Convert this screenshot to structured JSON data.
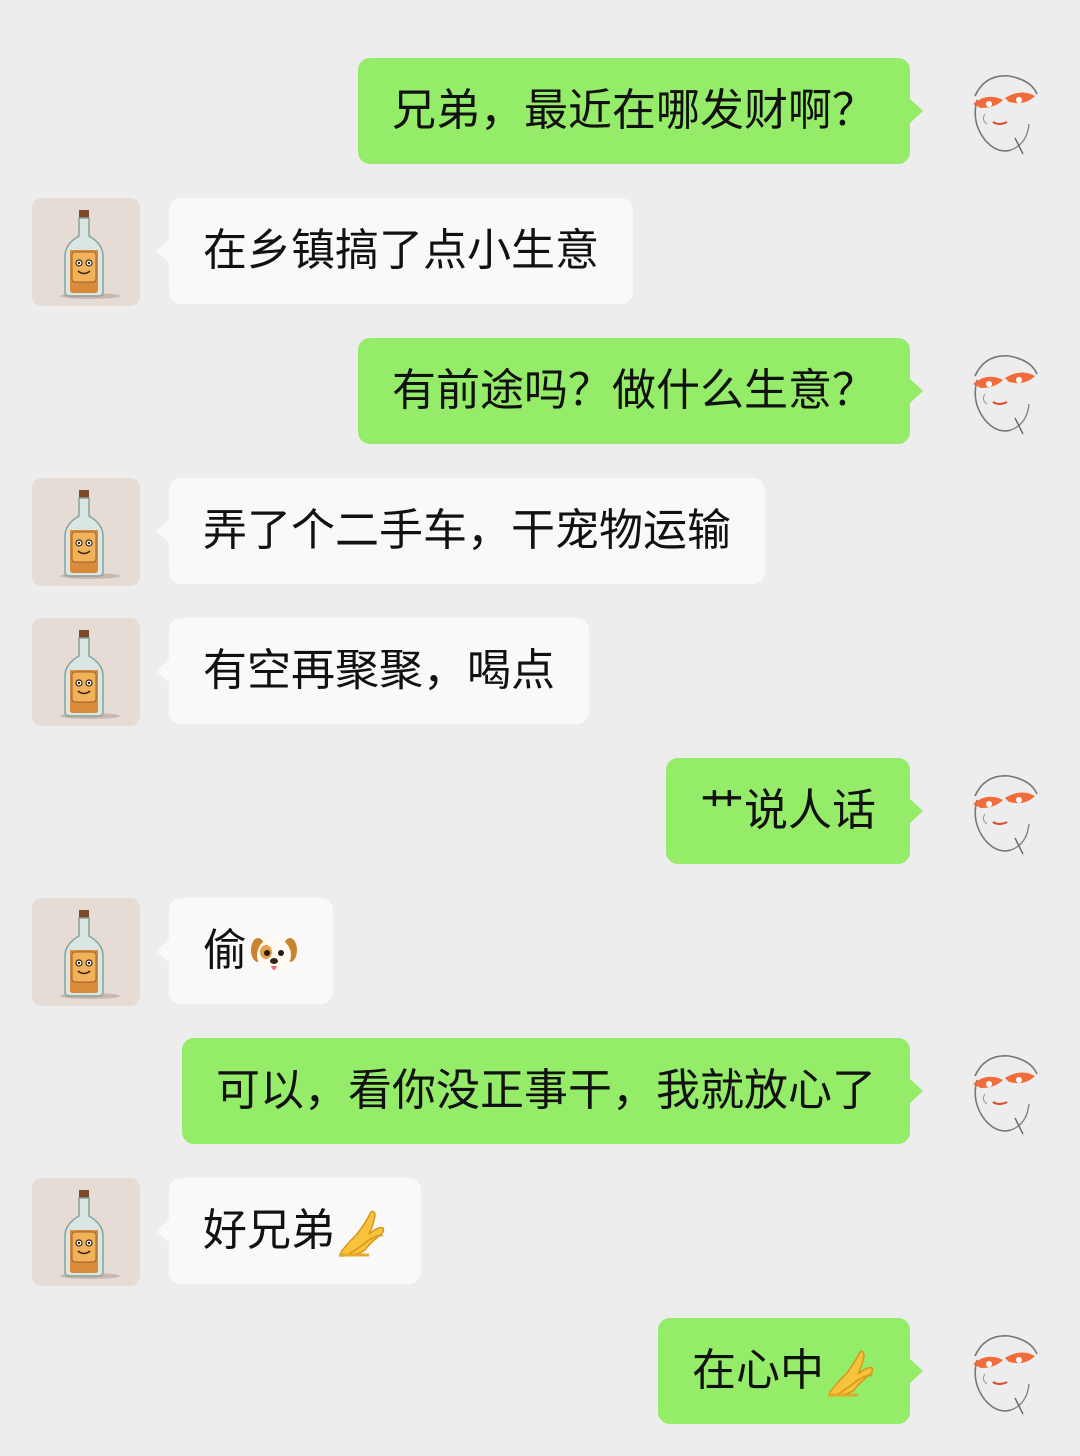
{
  "messages": [
    {
      "sender": "me",
      "text": "兄弟，最近在哪发财啊？",
      "avatar_icon": "sketch-face-avatar"
    },
    {
      "sender": "friend",
      "text": "在乡镇搞了点小生意",
      "avatar_icon": "bottle-avatar"
    },
    {
      "sender": "me",
      "text": "有前途吗？做什么生意？",
      "avatar_icon": "sketch-face-avatar"
    },
    {
      "sender": "friend",
      "text": "弄了个二手车，干宠物运输",
      "avatar_icon": "bottle-avatar"
    },
    {
      "sender": "friend",
      "text": "有空再聚聚，喝点",
      "avatar_icon": "bottle-avatar"
    },
    {
      "sender": "me",
      "text": "艹说人话",
      "avatar_icon": "sketch-face-avatar"
    },
    {
      "sender": "friend",
      "text": "偷",
      "emoji": "dog-face-emoji",
      "avatar_icon": "bottle-avatar"
    },
    {
      "sender": "me",
      "text": "可以，看你没正事干，我就放心了",
      "avatar_icon": "sketch-face-avatar"
    },
    {
      "sender": "friend",
      "text": "好兄弟",
      "emoji": "folded-hands-emoji",
      "avatar_icon": "bottle-avatar"
    },
    {
      "sender": "me",
      "text": "在心中",
      "emoji": "folded-hands-emoji",
      "avatar_icon": "sketch-face-avatar"
    }
  ],
  "colors": {
    "background": "#ededed",
    "outgoing_bubble": "#95ec69",
    "incoming_bubble": "#f9f9f9"
  }
}
